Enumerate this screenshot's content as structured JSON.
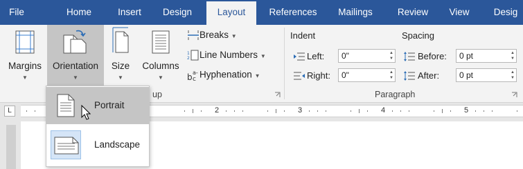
{
  "tabs": [
    "File",
    "Home",
    "Insert",
    "Design",
    "Layout",
    "References",
    "Mailings",
    "Review",
    "View",
    "Desig"
  ],
  "active_tab": "Layout",
  "page_setup": {
    "margins": "Margins",
    "orientation": "Orientation",
    "size": "Size",
    "columns": "Columns",
    "breaks": "Breaks",
    "line_numbers": "Line Numbers",
    "hyphenation": "Hyphenation",
    "group_label_partial": "up"
  },
  "paragraph": {
    "indent_heading": "Indent",
    "spacing_heading": "Spacing",
    "left_label": "Left:",
    "right_label": "Right:",
    "before_label": "Before:",
    "after_label": "After:",
    "left_value": "0\"",
    "right_value": "0\"",
    "before_value": "0 pt",
    "after_value": "0 pt",
    "group_label": "Paragraph"
  },
  "ruler": {
    "tab_selector": "L",
    "numbers": [
      "2",
      "3",
      "4",
      "5"
    ]
  },
  "orientation_menu": {
    "portrait": "Portrait",
    "landscape": "Landscape",
    "selected": "Landscape",
    "hovered": "Portrait"
  },
  "colors": {
    "tab_bar": "#2b579a",
    "ribbon": "#f3f3f3",
    "hover": "#c5c5c5",
    "selected": "#d5e5f7"
  }
}
